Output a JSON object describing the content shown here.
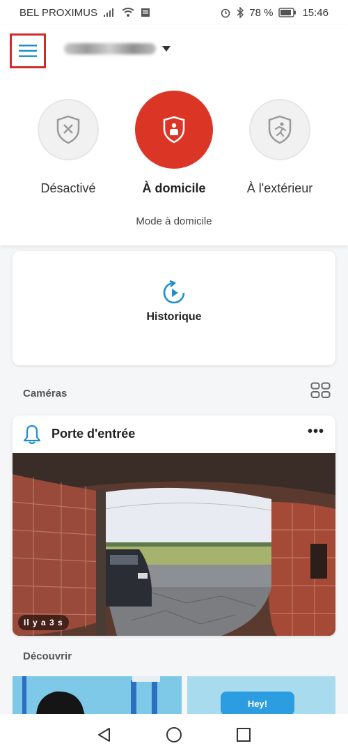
{
  "status": {
    "carrier": "BEL PROXIMUS",
    "battery": "78 %",
    "time": "15:46"
  },
  "modes": {
    "off": "Désactivé",
    "home": "À domicile",
    "away": "À l'extérieur",
    "current": "Mode à domicile",
    "accent": "#db3526"
  },
  "history": {
    "label": "Historique"
  },
  "cameras": {
    "title": "Caméras",
    "items": [
      {
        "name": "Porte d'entrée",
        "more": "•••",
        "time": "Il y a 3 s"
      }
    ]
  },
  "discover": {
    "title": "Découvrir",
    "promo_b": "Hey!"
  },
  "icons": {
    "menu": "hamburger-menu-icon",
    "dropdown": "chevron-down-icon",
    "off": "shield-x-icon",
    "home": "shield-person-icon",
    "away": "shield-running-icon",
    "history": "history-play-icon",
    "grid": "grid-view-icon",
    "bell": "bell-icon"
  }
}
